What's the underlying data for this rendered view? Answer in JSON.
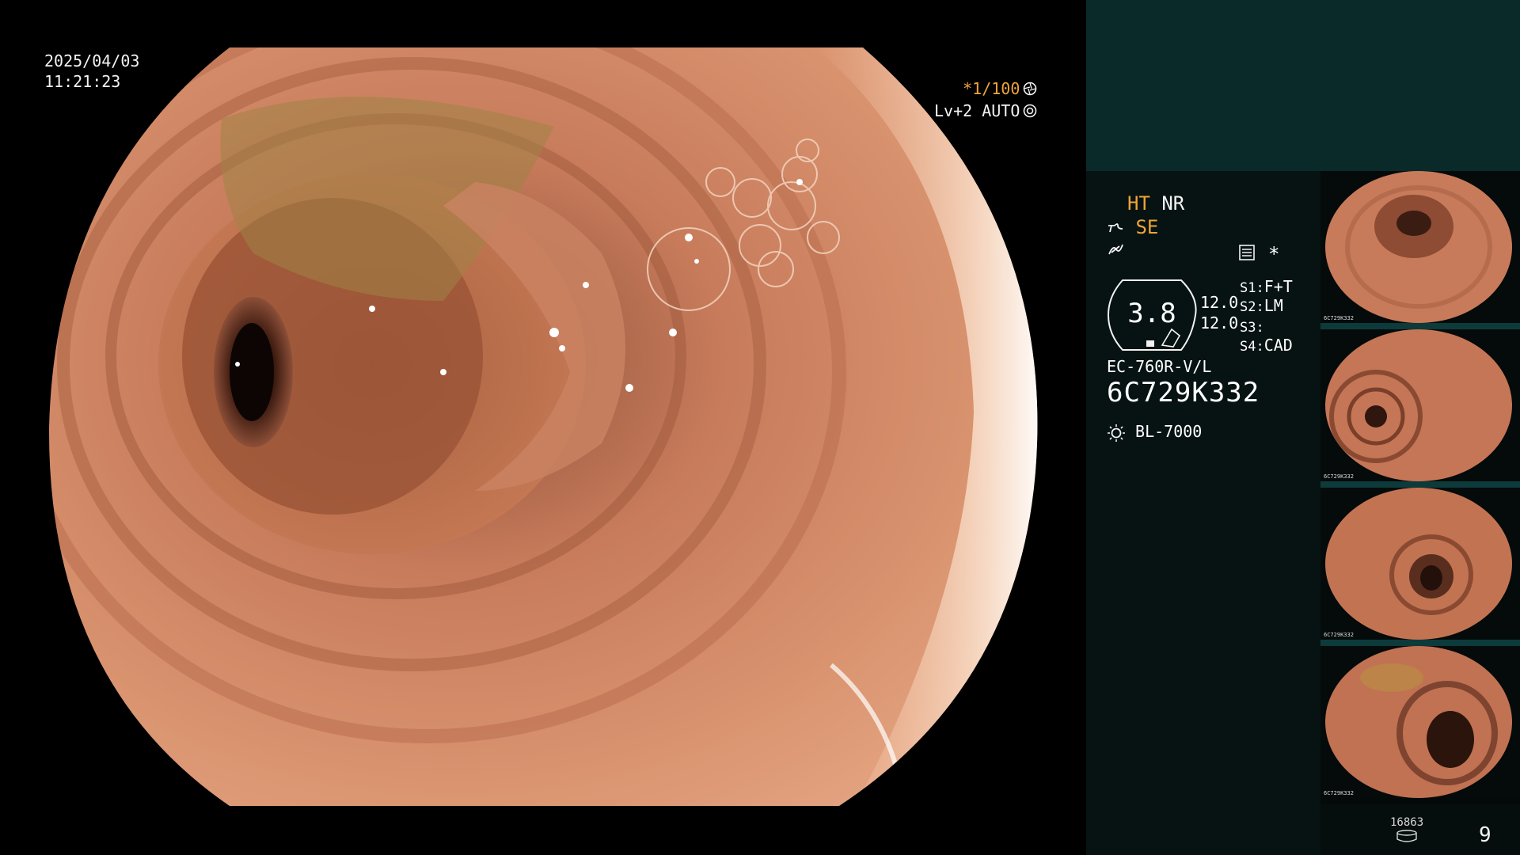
{
  "overlay": {
    "date": "2025/04/03",
    "time": "11:21:23",
    "shutter": "*1/100",
    "level_mode": "Lv+2 AUTO"
  },
  "info": {
    "ht": "HT",
    "nr": "NR",
    "se": "SE",
    "asterisk": "*",
    "gauge_value": "3.8",
    "val1": "12.0",
    "val2": "12.0",
    "s1_label": "S1:",
    "s1_value": "F+T",
    "s2_label": "S2:",
    "s2_value": "LM",
    "s3_label": "S3:",
    "s3_value": "",
    "s4_label": "S4:",
    "s4_value": "CAD",
    "scope_model": "EC-760R-V/L",
    "serial": "6C729K332",
    "light_source": "BL-7000"
  },
  "storage": {
    "count": "16863",
    "page": "9"
  },
  "colors": {
    "accent_orange": "#f0a43a",
    "panel_teal": "#0a2a2a",
    "panel_dark": "#071313"
  },
  "thumbnails": [
    {
      "caption": "6C729K332"
    },
    {
      "caption": "6C729K332"
    },
    {
      "caption": "6C729K332"
    },
    {
      "caption": "6C729K332"
    }
  ]
}
